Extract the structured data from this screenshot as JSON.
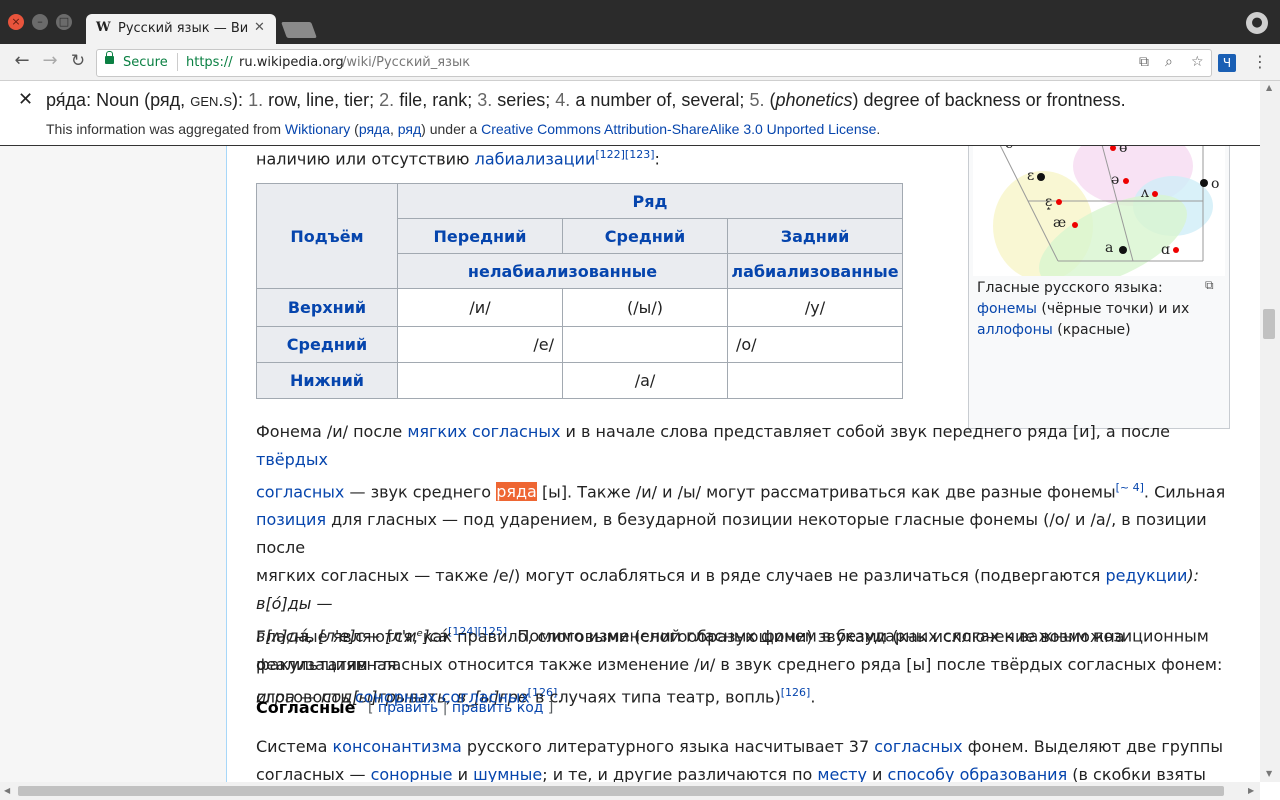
{
  "browser": {
    "tab_title": "Русский язык — Ви",
    "tab_favicon": "W",
    "secure_label": "Secure",
    "url_scheme": "https://",
    "url_host": "ru.wikipedia.org",
    "url_path": "/wiki/Русский_язык",
    "extension_label": "Ч"
  },
  "dict": {
    "close": "✕",
    "headword": "ря́да:",
    "pos": "Noun (ряд,",
    "gen": "gen.s",
    "gen_close": "):",
    "n1": "1.",
    "d1": "row, line, tier;",
    "n2": "2.",
    "d2": "file, rank;",
    "n3": "3.",
    "d3": "series;",
    "n4": "4.",
    "d4": "a number of, several;",
    "n5": "5.",
    "d5_pre": "(",
    "d5_it": "phonetics",
    "d5": ") degree of backness or frontness.",
    "src_pre": "This information was aggregated from",
    "src_wikt": "Wiktionary",
    "src_open": "(",
    "src_l1": "ряда",
    "src_comma": ",",
    "src_l2": "ряд",
    "src_close": ") under a",
    "src_license": "Creative Commons Attribution-ShareAlike 3.0 Unported License",
    "src_end": "."
  },
  "article": {
    "intro_pre": "наличию или отсутствию",
    "intro_link": "лабиализации",
    "intro_refs": "[122][123]",
    "intro_end": ":",
    "table": {
      "h_row": "Ряд",
      "h_rise": "Подъём",
      "h_front": "Передний",
      "h_central": "Средний",
      "h_back": "Задний",
      "h_unround": "нелабиализованные",
      "h_round": "лабиализованные",
      "rows": [
        {
          "label": "Верхний",
          "front": "/и/",
          "central": "(/ы/)",
          "back": "/у/"
        },
        {
          "label": "Средний",
          "front": "/е/",
          "central": "",
          "back": "/о/"
        },
        {
          "label": "Нижний",
          "central_span": "/а/"
        }
      ]
    },
    "figure": {
      "caption1": "Гласные русского языка:",
      "link1": "фонемы",
      "caption2": "(чёрные точки) и их",
      "link2": "аллофоны",
      "caption3": "(красные)",
      "symbols": [
        "e",
        "ɵ",
        "ɛ",
        "ə",
        "o",
        "ʌ",
        "ɛ̝",
        "æ",
        "a",
        "ɑ"
      ]
    },
    "p1": {
      "a": "Фонема /и/ после",
      "l1": "мягких согласных",
      "b": "и в начале слова представляет собой звук переднего ряда [и], а после",
      "l2a": "твёрдых",
      "l2b": "согласных",
      "c": "— звук среднего",
      "hl": "ряда",
      "d": "[ы]. Также /и/ и /ы/ могут рассматриваться как две разные фонемы",
      "ref1": "[~ 4]",
      "e": ". Сильная",
      "l3": "позиция",
      "f": "для гласных — под ударением, в безударной позиции некоторые гласные фонемы (/о/ и /а/, в позиции после",
      "g": "мягких согласных — также /е/) могут ослабляться и в ряде случаев не различаться (подвергаются",
      "l4": "редукции",
      "h": "): в[о́]ды —",
      "i": "в[ʌ]да́, [л'е]с— [л'иᵉ]са́",
      "ref2": "[124][125]",
      "j": ". Помимо изменений гласных фонем в безударных слогах к важным позиционным",
      "k": "реализациям гласных относится также изменение /и/ в звук среднего ряда [ы] после твёрдых согласных фонем:",
      "l": "игра — под[ы]грывать, в_[ы]гре",
      "ref3": "[126]",
      "m": "."
    },
    "p2": {
      "a": "Гласные являются, как правило, слоговыми (слогообразующими) звуками (как исключение возможна факультативная",
      "b": "слоговость",
      "l1": "сонорных согласных",
      "c": "в случаях типа театр, вопль)",
      "ref": "[126]",
      "d": "."
    },
    "section": {
      "heading": "Согласные",
      "open": "[",
      "edit": "править",
      "sep": "|",
      "edit_code": "править код",
      "close": "]"
    },
    "p3": {
      "a": "Система",
      "l1": "консонантизма",
      "b": "русского литературного языка насчитывает 37",
      "l2": "согласных",
      "c": "фонем. Выделяют две группы",
      "d": "согласных —",
      "l3": "сонорные",
      "e": "и",
      "l4": "шумные",
      "f": "; и те, и другие различаются по",
      "l5": "месту",
      "g": "и",
      "l6": "способу образования",
      "h": "(в скобки взяты"
    }
  }
}
